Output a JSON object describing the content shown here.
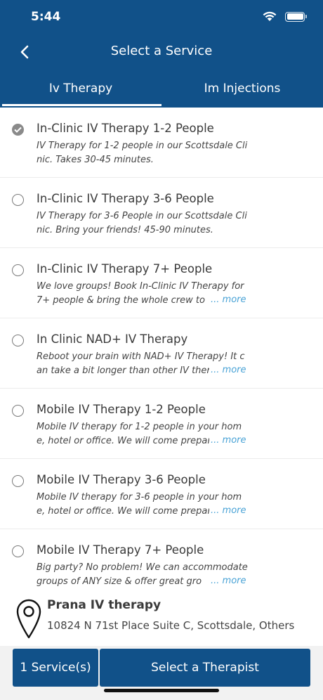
{
  "status_bar": {
    "time": "5:44"
  },
  "nav": {
    "title": "Select a Service"
  },
  "tabs": [
    {
      "label": "Iv Therapy",
      "active": true
    },
    {
      "label": "Im Injections",
      "active": false
    }
  ],
  "services": [
    {
      "title": "In-Clinic IV Therapy 1-2 People",
      "description": "IV Therapy for 1-2 people in our Scottsdale Clinic. Takes 30-45 minutes.",
      "more": "",
      "selected": true
    },
    {
      "title": "In-Clinic IV Therapy 3-6 People",
      "description": "IV Therapy for 3-6 People in our Scottsdale Clinic. Bring your friends! 45-90 minutes.",
      "more": "",
      "selected": false
    },
    {
      "title": "In-Clinic IV Therapy 7+ People",
      "description": "We love groups! Book In-Clinic IV Therapy for 7+ people & bring the whole crew to",
      "more": "... more",
      "selected": false
    },
    {
      "title": "In Clinic NAD+ IV Therapy",
      "description": "Reboot your brain with NAD+ IV Therapy! It can take a bit longer than other IV ther",
      "more": "... more",
      "selected": false
    },
    {
      "title": "Mobile IV Therapy 1-2 People",
      "description": "Mobile IV therapy for 1-2 people in your home, hotel or office. We will come prepare",
      "more": "... more",
      "selected": false
    },
    {
      "title": "Mobile IV Therapy 3-6 People",
      "description": "Mobile IV therapy for 3-6 people in your home, hotel or office. We will come prepare",
      "more": "... more",
      "selected": false
    },
    {
      "title": "Mobile IV Therapy 7+ People",
      "description": "Big party? No problem! We can accommodate groups of ANY size & offer great gro",
      "more": "... more",
      "selected": false
    }
  ],
  "location": {
    "name": "Prana IV therapy",
    "address": "10824 N 71st Place Suite C, Scottsdale, Others"
  },
  "footer": {
    "count_label": "1 Service(s)",
    "action_label": "Select a Therapist"
  },
  "colors": {
    "primary": "#115189",
    "link": "#4aa3d6"
  },
  "icons": {
    "back": "chevron-left-icon",
    "location": "map-pin-icon",
    "selected": "check-circle-icon"
  }
}
